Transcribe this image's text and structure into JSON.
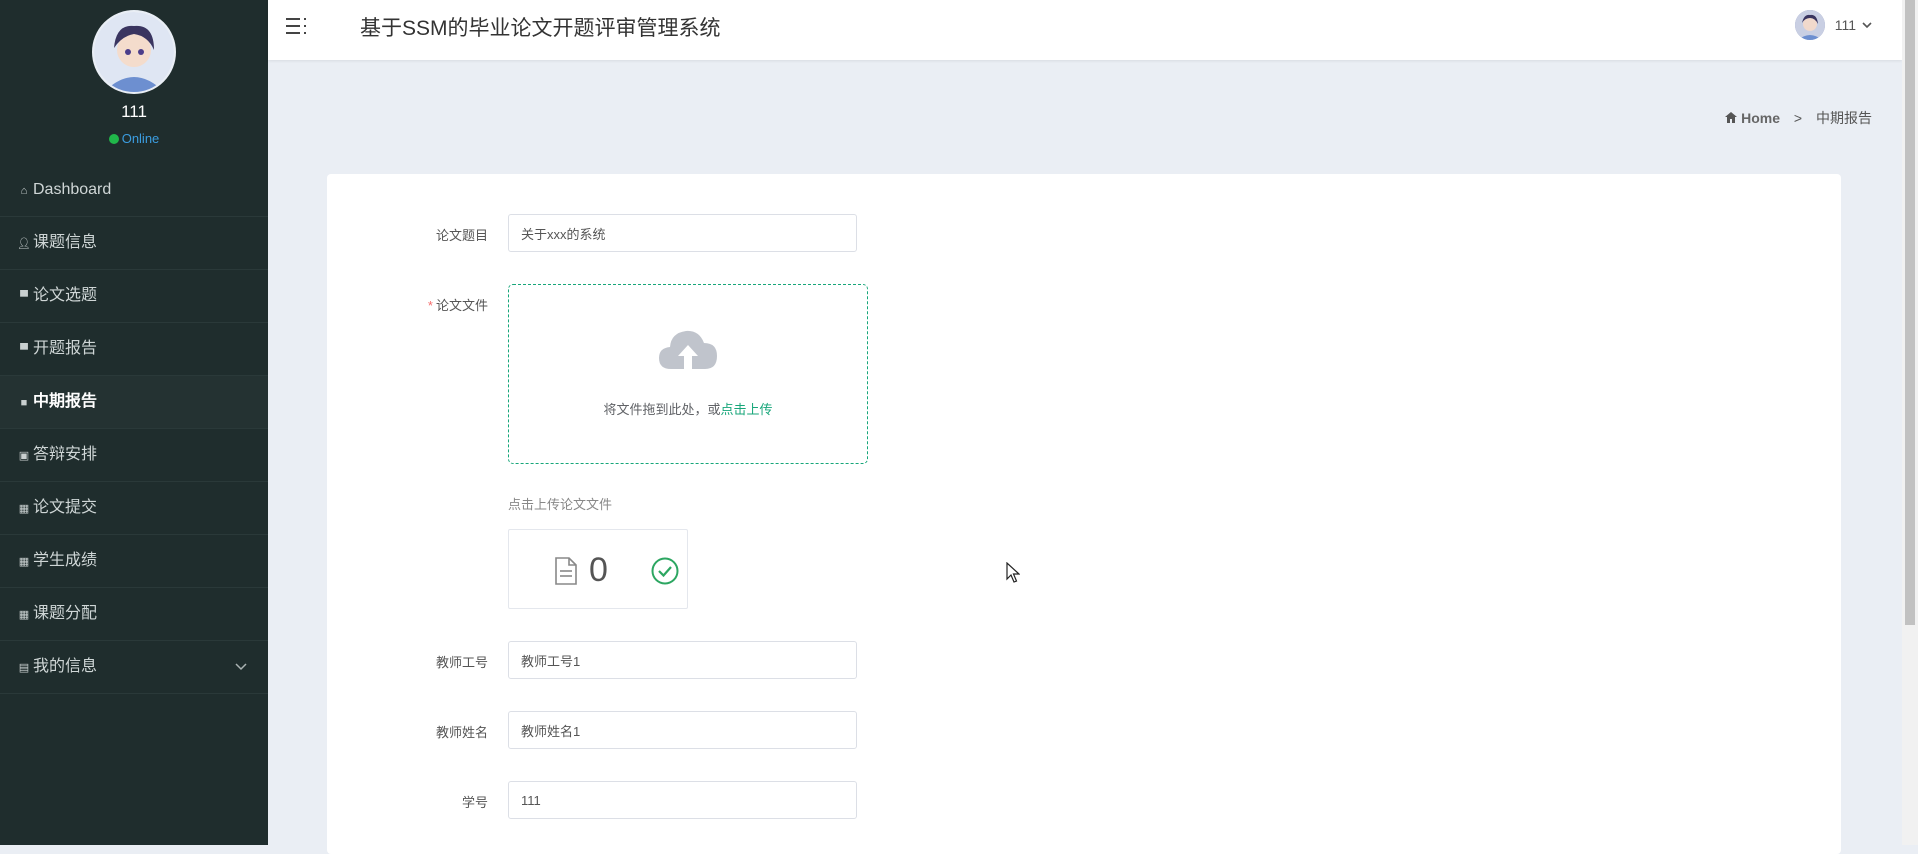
{
  "sidebar": {
    "user_name": "111",
    "status": "Online",
    "items": [
      {
        "label": "Dashboard",
        "icon": "home-icon"
      },
      {
        "label": "课题信息",
        "icon": "user-icon"
      },
      {
        "label": "论文选题",
        "icon": "monitor-icon"
      },
      {
        "label": "开题报告",
        "icon": "comment-icon"
      },
      {
        "label": "中期报告",
        "icon": "lock-icon",
        "active": true
      },
      {
        "label": "答辩安排",
        "icon": "checkbox-icon"
      },
      {
        "label": "论文提交",
        "icon": "grid-icon"
      },
      {
        "label": "学生成绩",
        "icon": "grid-icon"
      },
      {
        "label": "课题分配",
        "icon": "grid-icon"
      },
      {
        "label": "我的信息",
        "icon": "folder-icon",
        "expandable": true
      }
    ]
  },
  "header": {
    "title": "基于SSM的毕业论文开题评审管理系统",
    "user": "111"
  },
  "breadcrumb": {
    "home": "Home",
    "separator": ">",
    "current": "中期报告"
  },
  "form": {
    "thesis_title_label": "论文题目",
    "thesis_title_value": "关于xxx的系统",
    "thesis_file_label": "论文文件",
    "required_mark": "*",
    "upload_text": "将文件拖到此处，或",
    "upload_link": "点击上传",
    "upload_tip": "点击上传论文文件",
    "file_count": "0",
    "teacher_id_label": "教师工号",
    "teacher_id_value": "教师工号1",
    "teacher_name_label": "教师姓名",
    "teacher_name_value": "教师姓名1",
    "student_id_label": "学号",
    "student_id_value": "111"
  },
  "colors": {
    "sidebar_bg": "#1f2d2d",
    "accent": "#17a67a",
    "online": "#20b74a",
    "required": "#f56c6c"
  }
}
